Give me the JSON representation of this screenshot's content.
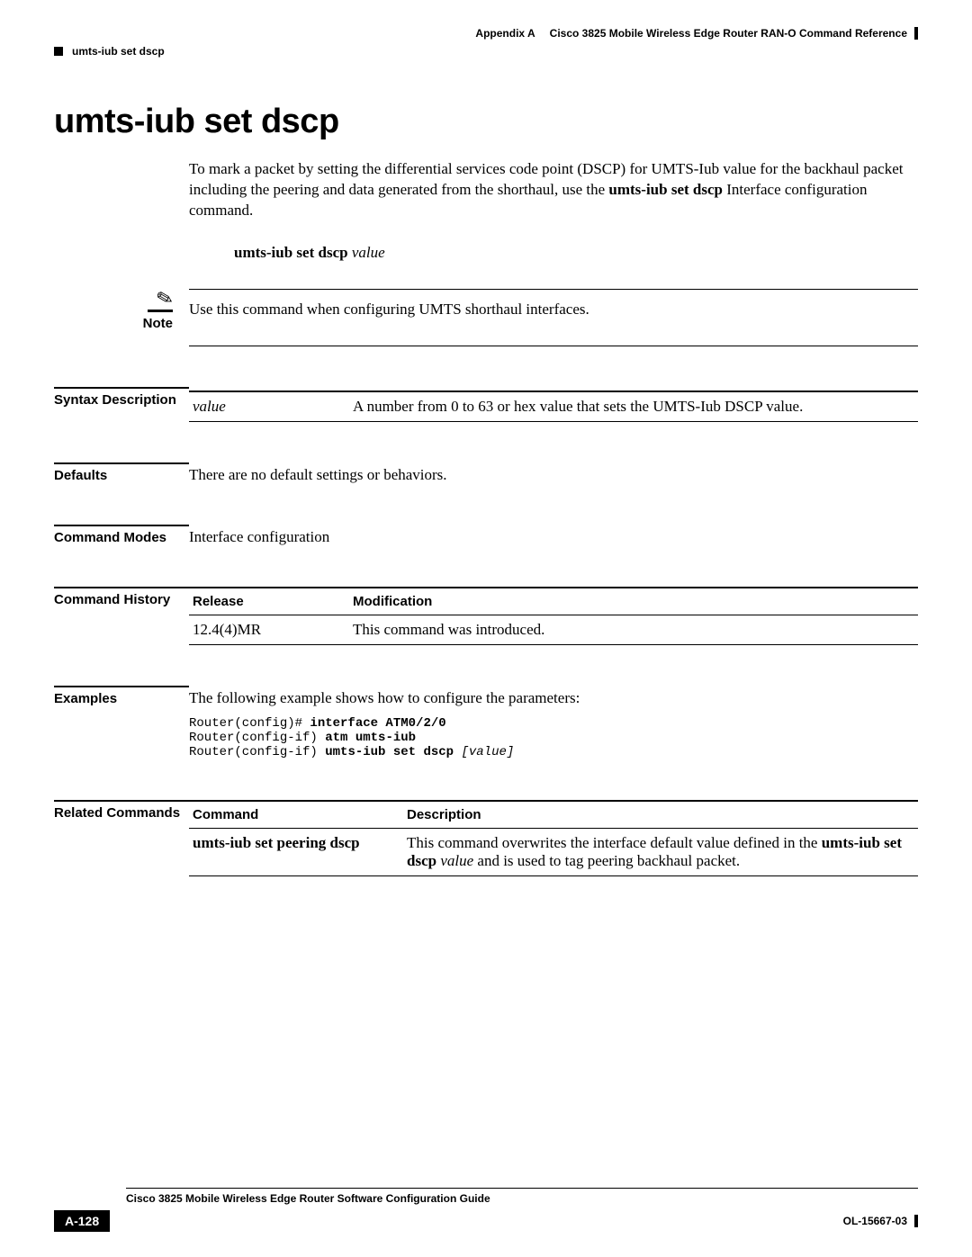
{
  "header": {
    "appendix": "Appendix A",
    "doc_title": "Cisco 3825 Mobile Wireless Edge Router RAN-O Command Reference",
    "running_head": "umts-iub set dscp"
  },
  "title": "umts-iub set dscp",
  "intro": {
    "part1": "To mark a packet by setting the differential services code point (DSCP) for UMTS-Iub value for the backhaul packet including the peering and data generated from the shorthaul, use the ",
    "cmd": "umts-iub set dscp",
    "part2": " Interface configuration command."
  },
  "syntax_line": {
    "cmd": "umts-iub set dscp",
    "arg": "value"
  },
  "note": {
    "label": "Note",
    "text": "Use this command when configuring UMTS shorthaul interfaces."
  },
  "sections": {
    "syntax_desc_label": "Syntax Description",
    "syntax_desc": {
      "param": "value",
      "desc": "A number from 0 to 63 or hex value that sets the UMTS-Iub DSCP value."
    },
    "defaults_label": "Defaults",
    "defaults_text": "There are no default settings or behaviors.",
    "modes_label": "Command Modes",
    "modes_text": "Interface configuration",
    "history_label": "Command History",
    "history": {
      "col_release": "Release",
      "col_mod": "Modification",
      "release": "12.4(4)MR",
      "modification": "This command was introduced."
    },
    "examples_label": "Examples",
    "examples_intro": "The following example shows how to configure the parameters:",
    "code": {
      "l1a": "Router(config)# ",
      "l1b": "interface ATM0/2/0",
      "l2a": "Router(config-if) ",
      "l2b": "atm umts-iub",
      "l3a": "Router(config-if) ",
      "l3b": "umts-iub set dscp ",
      "l3c": "[value]"
    },
    "related_label": "Related Commands",
    "related": {
      "col_cmd": "Command",
      "col_desc": "Description",
      "cmd": "umts-iub set peering dscp",
      "desc_part1": "This command overwrites the interface default value defined in the ",
      "desc_bold": "umts-iub set dscp",
      "desc_italic": " value",
      "desc_part2": " and is used to tag peering backhaul packet."
    }
  },
  "footer": {
    "guide_title": "Cisco 3825 Mobile Wireless Edge Router Software Configuration Guide",
    "page_num": "A-128",
    "doc_id": "OL-15667-03"
  }
}
